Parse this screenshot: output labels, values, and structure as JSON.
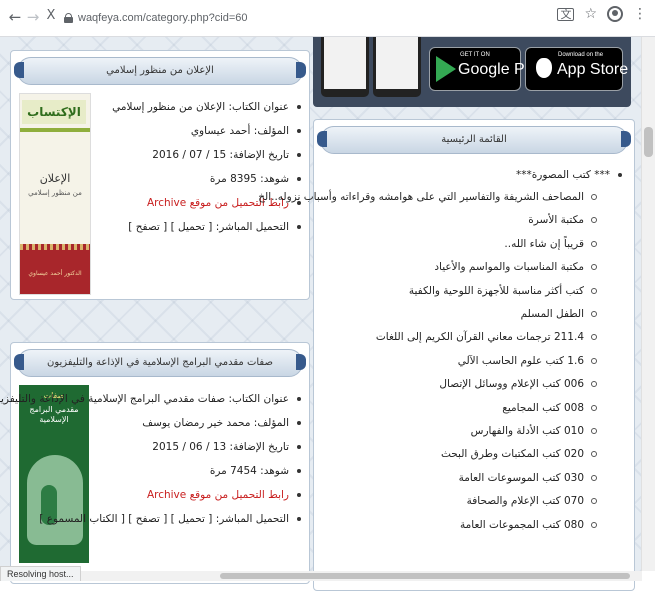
{
  "browser": {
    "back_icon": "←",
    "forward_icon": "→",
    "stop_icon": "X",
    "url": "waqfeya.com/category.php?cid=60",
    "translate_icon": "translate-icon",
    "star_icon": "☆",
    "menu_icon": "⋮"
  },
  "status_text": "Resolving host...",
  "app_banner": {
    "google_small": "GET IT ON",
    "google_big": "Google Play",
    "apple_small": "Download on the",
    "apple_big": "App Store"
  },
  "book1": {
    "header": "الإعلان من منظور إسلامي",
    "title": "عنوان الكتاب: الإعلان من منظور إسلامي",
    "author": "المؤلف: أحمد عيساوي",
    "date": "تاريخ الإضافة: 15 / 07 / 2016",
    "views": "شوهد: 8395 مرة",
    "archive": "رابط التحميل من موقع Archive",
    "direct": "التحميل المباشر: [ تحميل ] [ تصفح ]",
    "cover_logo": "الإكتساب",
    "cover_title": "الإعلان",
    "cover_subtitle": "من منظور إسلامي",
    "cover_author": "الدكتور أحمد عيساوي"
  },
  "book2": {
    "header": "صفات مقدمي البرامج الإسلامية في الإذاعة والتليفزيون",
    "title": "عنوان الكتاب: صفات مقدمي البرامج الإسلامية في الإذاعة والتليفزيون",
    "author": "المؤلف: محمد خير رمضان يوسف",
    "date": "تاريخ الإضافة: 13 / 06 / 2015",
    "views": "شوهد: 7454 مرة",
    "archive": "رابط التحميل من موقع Archive",
    "direct": "التحميل المباشر: [ تحميل ] [ تصفح ] [ الكتاب المسموع ]",
    "cover_title": "مقدمي البرامج الإسلامية",
    "cover_top": "صفات"
  },
  "main_menu": {
    "header": "القائمة الرئيسية",
    "top_item": "*** كتب المصورة***",
    "items": [
      "المصاحف الشريفة والتفاسير التي على هوامشه وقراءاته وأسباب نزوله..الخ",
      "مكتبة الأسرة",
      "قريباً إن شاء الله..",
      "مكتبة المناسبات والمواسم والأعياد",
      "كتب أكثر مناسبة للأجهزة اللوحية والكفية",
      "الطفل المسلم",
      "211.4 ترجمات معاني القرآن الكريم إلى اللغات",
      "1.6 كتب علوم الحاسب الآلي",
      "006 كتب الإعلام ووسائل الإتصال",
      "008 كتب المجاميع",
      "010 كتب الأدلة والفهارس",
      "020 كتب المكتبات وطرق البحث",
      "030 كتب الموسوعات العامة",
      "070 كتب الإعلام والصحافة",
      "080 كتب المجموعات العامة"
    ]
  },
  "colors": {
    "panel_border": "#b9c7d6",
    "header_cap": "#375a8c",
    "archive_red": "#c81e1e",
    "banner_bg": "#3d4a5e"
  }
}
